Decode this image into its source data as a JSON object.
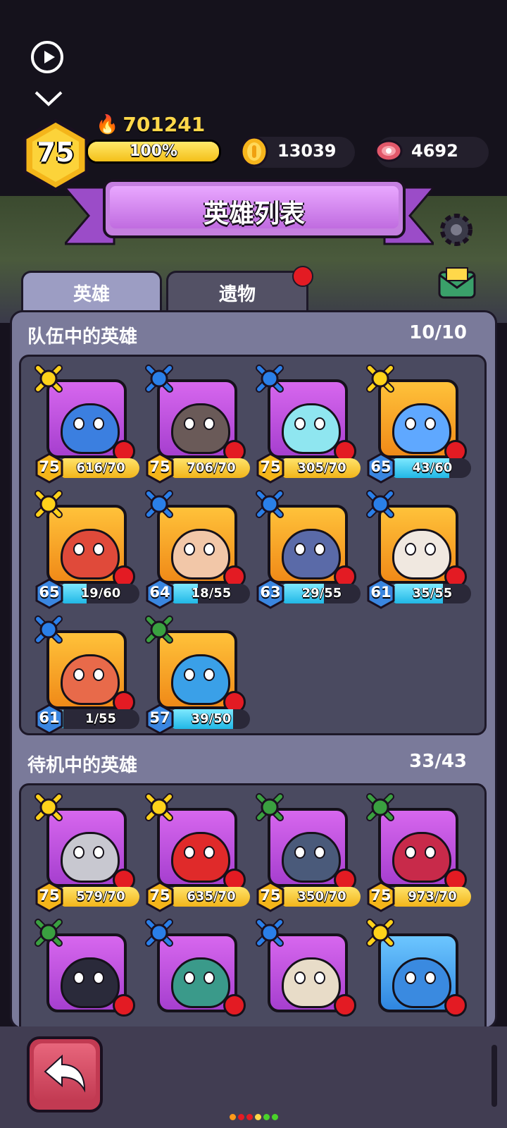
{
  "header": {
    "level": "75",
    "power": "701241",
    "xp_percent": "100%",
    "xp_fill": 1.0,
    "coins": "13039",
    "meat": "4692"
  },
  "title": "英雄列表",
  "tabs": [
    {
      "label": "英雄",
      "active": true
    },
    {
      "label": "遗物",
      "active": false,
      "has_notification": true
    }
  ],
  "team": {
    "title": "队伍中的英雄",
    "count": "10/10",
    "heroes": [
      {
        "level": "75",
        "progress": "616/70",
        "fill": 1.0,
        "bar": "gold",
        "frame": "purple",
        "badge": "yellow",
        "icon": "skull-hat-hero",
        "color": "#3b7fe0"
      },
      {
        "level": "75",
        "progress": "706/70",
        "fill": 1.0,
        "bar": "gold",
        "frame": "purple",
        "badge": "blue",
        "icon": "tree-stump-hero",
        "color": "#6a5a58"
      },
      {
        "level": "75",
        "progress": "305/70",
        "fill": 1.0,
        "bar": "gold",
        "frame": "purple",
        "badge": "blue",
        "icon": "bunny-hero",
        "color": "#8fe6f0"
      },
      {
        "level": "65",
        "progress": "43/60",
        "fill": 0.72,
        "bar": "cyan",
        "frame": "orange",
        "badge": "yellow",
        "icon": "knight-helmet-hero",
        "color": "#5fa8ff"
      },
      {
        "level": "65",
        "progress": "19/60",
        "fill": 0.32,
        "bar": "cyan",
        "frame": "orange",
        "badge": "yellow",
        "icon": "fire-hair-hero",
        "color": "#e04a3a"
      },
      {
        "level": "64",
        "progress": "18/55",
        "fill": 0.33,
        "bar": "cyan",
        "frame": "orange",
        "badge": "blue",
        "icon": "pharaoh-hero",
        "color": "#f2c7a8"
      },
      {
        "level": "63",
        "progress": "29/55",
        "fill": 0.53,
        "bar": "cyan",
        "frame": "orange",
        "badge": "blue",
        "icon": "hooded-ninja-hero",
        "color": "#5a6aa8"
      },
      {
        "level": "61",
        "progress": "35/55",
        "fill": 0.64,
        "bar": "cyan",
        "frame": "orange",
        "badge": "blue",
        "icon": "monkey-king-hero",
        "color": "#f0e8e0"
      },
      {
        "level": "61",
        "progress": "1/55",
        "fill": 0.02,
        "bar": "cyan",
        "frame": "orange",
        "badge": "blue",
        "icon": "snail-hero",
        "color": "#e86a4a"
      },
      {
        "level": "57",
        "progress": "39/50",
        "fill": 0.78,
        "bar": "cyan",
        "frame": "orange",
        "badge": "green",
        "icon": "blue-cat-hero",
        "color": "#3aa0e8"
      }
    ]
  },
  "standby": {
    "title": "待机中的英雄",
    "count": "33/43",
    "heroes": [
      {
        "level": "75",
        "progress": "579/70",
        "fill": 1.0,
        "bar": "gold",
        "frame": "purple",
        "badge": "yellow",
        "icon": "armored-knight-hero",
        "color": "#c8c8d0"
      },
      {
        "level": "75",
        "progress": "635/70",
        "fill": 1.0,
        "bar": "gold",
        "frame": "purple",
        "badge": "yellow",
        "icon": "archer-hero",
        "color": "#e02a2a"
      },
      {
        "level": "75",
        "progress": "350/70",
        "fill": 1.0,
        "bar": "gold",
        "frame": "purple",
        "badge": "green",
        "icon": "spiked-cat-hero",
        "color": "#4a5a7a"
      },
      {
        "level": "75",
        "progress": "973/70",
        "fill": 1.0,
        "bar": "gold",
        "frame": "purple",
        "badge": "green",
        "icon": "robot-hero",
        "color": "#c82a4a"
      },
      {
        "level": "",
        "progress": "",
        "fill": 0,
        "bar": "gold",
        "frame": "purple",
        "badge": "green",
        "icon": "leaf-sprite-hero",
        "color": "#2a2a3a"
      },
      {
        "level": "",
        "progress": "",
        "fill": 0,
        "bar": "gold",
        "frame": "purple",
        "badge": "blue",
        "icon": "shark-hero",
        "color": "#3a9a8a"
      },
      {
        "level": "",
        "progress": "",
        "fill": 0,
        "bar": "gold",
        "frame": "purple",
        "badge": "blue",
        "icon": "mummy-hero",
        "color": "#e8dcc8"
      },
      {
        "level": "",
        "progress": "",
        "fill": 0,
        "bar": "gold",
        "frame": "blue",
        "badge": "yellow",
        "icon": "viking-hero",
        "color": "#3a8ae0"
      }
    ]
  },
  "colors": {
    "accent_purple": "#c57fe0",
    "gold": "#f4c019",
    "notification": "#e31b23",
    "back_button": "#c23a52"
  },
  "page_dots": [
    "#ff9a1a",
    "#e31b23",
    "#e31b23",
    "#ffd84a",
    "#4ad22a",
    "#4ad22a"
  ]
}
